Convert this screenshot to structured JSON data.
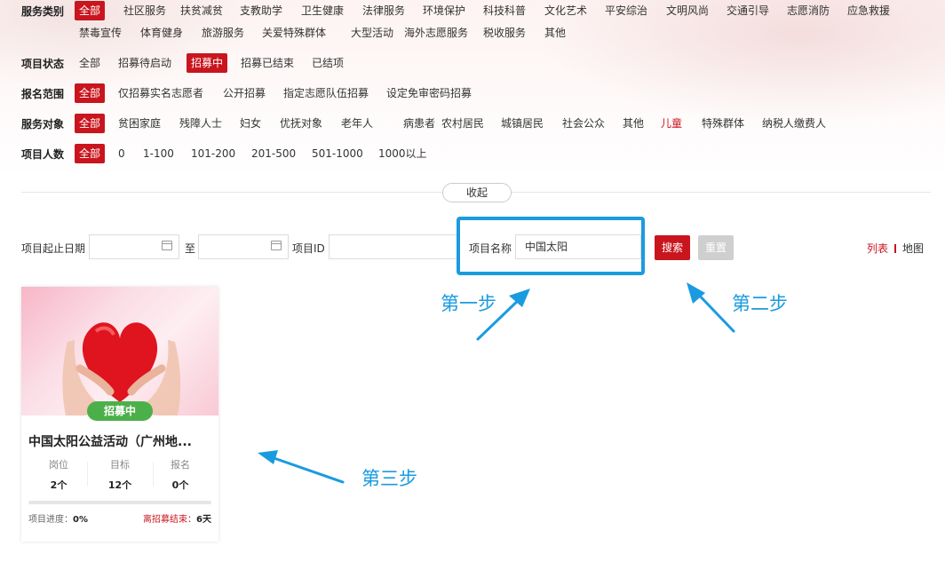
{
  "filters": {
    "service_type": {
      "label": "服务类别",
      "options": [
        "全部",
        "社区服务",
        "扶贫减贫",
        "支教助学",
        "卫生健康",
        "法律服务",
        "环境保护",
        "科技科普",
        "文化艺术",
        "平安综治",
        "文明风尚",
        "交通引导",
        "志愿消防",
        "应急救援",
        "禁毒宣传",
        "体育健身",
        "旅游服务",
        "关爱特殊群体",
        "大型活动",
        "海外志愿服务",
        "税收服务",
        "其他"
      ],
      "selected": "全部"
    },
    "status": {
      "label": "项目状态",
      "options": [
        "全部",
        "招募待启动",
        "招募中",
        "招募已结束",
        "已结项"
      ],
      "selected": "招募中"
    },
    "scope": {
      "label": "报名范围",
      "options": [
        "全部",
        "仅招募实名志愿者",
        "公开招募",
        "指定志愿队伍招募",
        "设定免审密码招募"
      ],
      "selected": "全部"
    },
    "target": {
      "label": "服务对象",
      "options": [
        "全部",
        "贫困家庭",
        "残障人士",
        "妇女",
        "优抚对象",
        "老年人",
        "病患者",
        "农村居民",
        "城镇居民",
        "社会公众",
        "其他",
        "儿童",
        "特殊群体",
        "纳税人缴费人"
      ],
      "selected": "全部",
      "highlighted": "儿童"
    },
    "size": {
      "label": "项目人数",
      "options": [
        "全部",
        "0",
        "1-100",
        "101-200",
        "201-500",
        "501-1000",
        "1000以上"
      ],
      "selected": "全部"
    }
  },
  "collapse_label": "收起",
  "search": {
    "date_label": "项目起止日期",
    "to_label": "至",
    "start_date": "",
    "end_date": "",
    "id_label": "项目ID",
    "id_value": "",
    "name_label": "项目名称",
    "name_value": "中国太阳",
    "search_button": "搜索",
    "reset_button": "重置"
  },
  "view": {
    "list": "列表",
    "map": "地图",
    "active": "列表"
  },
  "annotations": {
    "step1": "第一步",
    "step2": "第二步",
    "step3": "第三步",
    "color": "#1a9be0"
  },
  "project_card": {
    "status_badge": "招募中",
    "title": "中国太阳公益活动（广州地...",
    "stats": [
      {
        "label": "岗位",
        "value": "2个"
      },
      {
        "label": "目标",
        "value": "12个"
      },
      {
        "label": "报名",
        "value": "0个"
      }
    ],
    "progress_label": "项目进度：",
    "progress_value": "0%",
    "progress_fraction": 0,
    "deadline_label": "离招募结束：",
    "deadline_value": "6天"
  },
  "colors": {
    "accent": "#c9151e",
    "badge_green": "#4cb04a",
    "annotation_blue": "#1a9be0"
  }
}
